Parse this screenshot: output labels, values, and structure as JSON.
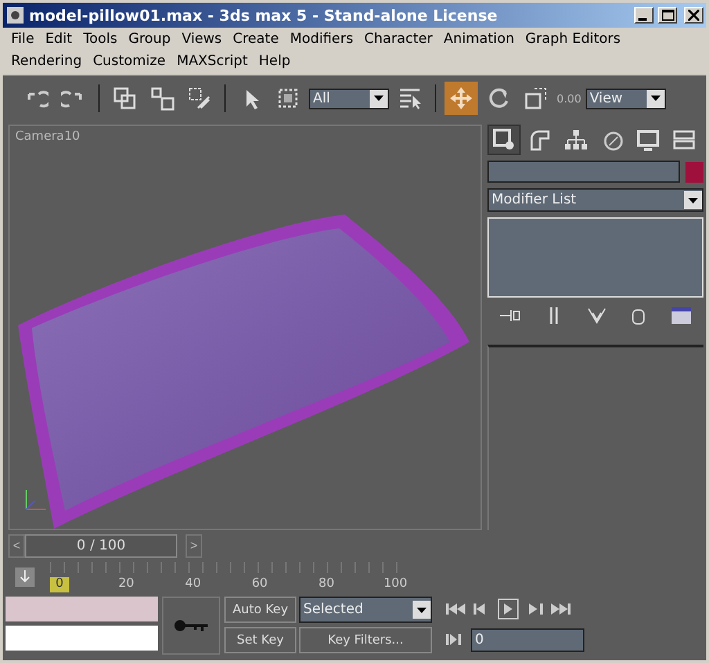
{
  "window": {
    "title": "model-pillow01.max - 3ds max 5 - Stand-alone License"
  },
  "menu": [
    "File",
    "Edit",
    "Tools",
    "Group",
    "Views",
    "Create",
    "Modifiers",
    "Character",
    "Animation",
    "Graph Editors",
    "Rendering",
    "Customize",
    "MAXScript",
    "Help"
  ],
  "toolbar": {
    "tools": [
      {
        "kind": "undo",
        "selected": false
      },
      {
        "kind": "redo",
        "selected": false
      },
      {
        "kind": "link",
        "selected": false
      },
      {
        "kind": "unlink",
        "selected": false
      },
      {
        "kind": "bind",
        "selected": false
      },
      {
        "kind": "select",
        "selected": false
      },
      {
        "kind": "region",
        "selected": false
      },
      {
        "kind": "byname",
        "selected": false
      },
      {
        "kind": "move",
        "selected": true
      },
      {
        "kind": "rotate",
        "selected": false
      },
      {
        "kind": "scale",
        "selected": false
      }
    ],
    "selection_filter": "All",
    "coordinate_system": "View",
    "spinner_value": "0.00"
  },
  "viewport": {
    "label": "Camera10"
  },
  "command_panel": {
    "tabs": [
      {
        "kind": "create",
        "selected": true
      },
      {
        "kind": "modify",
        "selected": false
      },
      {
        "kind": "hierarchy",
        "selected": false
      },
      {
        "kind": "motion",
        "selected": false
      },
      {
        "kind": "display",
        "selected": false
      },
      {
        "kind": "utilities",
        "selected": false
      }
    ],
    "modifier_list": "Modifier List"
  },
  "time_slider": {
    "level": 0,
    "position": "0 / 100",
    "prev": "<",
    "next": ">"
  },
  "ruler": {
    "ticks": [
      "0",
      "20",
      "40",
      "60",
      "80",
      "100"
    ]
  },
  "bottom": {
    "auto_key": "Auto Key",
    "set_key": "Set Key",
    "key_mode": "Selected",
    "key_filters": "Key Filters...",
    "frame": "0"
  }
}
